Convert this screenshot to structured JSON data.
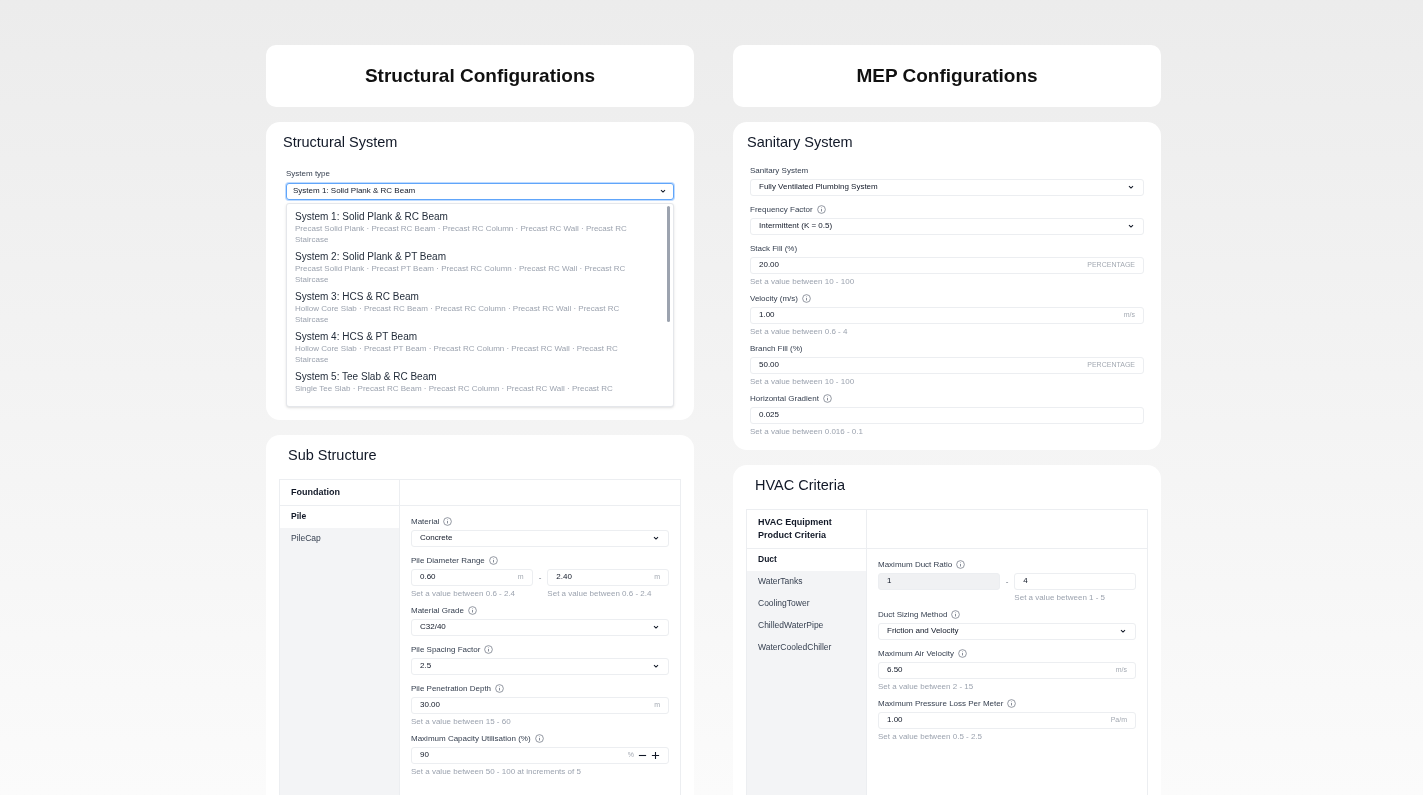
{
  "columns": [
    {
      "heading": "Structural Configurations",
      "sections": [
        {
          "kind": "system",
          "title": "Structural System",
          "field_label": "System type",
          "value": "System 1: Solid Plank & RC Beam",
          "open": true,
          "options": [
            {
              "name": "System 1: Solid Plank & RC Beam",
              "description": "Precast Solid Plank · Precast RC Beam · Precast RC Column · Precast RC Wall · Precast RC Staircase"
            },
            {
              "name": "System 2: Solid Plank & PT Beam",
              "description": "Precast Solid Plank · Precast PT Beam · Precast RC Column · Precast RC Wall · Precast RC Staircase"
            },
            {
              "name": "System 3: HCS & RC Beam",
              "description": "Hollow Core Slab · Precast RC Beam · Precast RC Column · Precast RC Wall · Precast RC Staircase"
            },
            {
              "name": "System 4: HCS & PT Beam",
              "description": "Hollow Core Slab · Precast PT Beam · Precast RC Column · Precast RC Wall · Precast RC Staircase"
            },
            {
              "name": "System 5: Tee Slab & RC Beam",
              "description": "Single Tee Slab · Precast RC Beam · Precast RC Column · Precast RC Wall · Precast RC"
            }
          ]
        },
        {
          "kind": "tabbed",
          "title": "Sub Structure",
          "group": "Foundation",
          "tabs": [
            {
              "label": "Pile",
              "selected": true
            },
            {
              "label": "PileCap",
              "selected": false
            }
          ],
          "fields": [
            {
              "kind": "select",
              "label": "Material",
              "info": true,
              "value": "Concrete"
            },
            {
              "kind": "range",
              "label": "Pile Diameter Range",
              "info": true,
              "separator": "-",
              "min": {
                "value": "0.60",
                "unit": "m",
                "hint": "Set a value between 0.6 - 2.4",
                "disabled": false
              },
              "max": {
                "value": "2.40",
                "unit": "m",
                "hint": "Set a value between 0.6 - 2.4",
                "disabled": false
              }
            },
            {
              "kind": "select",
              "label": "Material Grade",
              "info": true,
              "value": "C32/40"
            },
            {
              "kind": "select",
              "label": "Pile Spacing Factor",
              "info": true,
              "value": "2.5"
            },
            {
              "kind": "number",
              "label": "Pile Penetration Depth",
              "info": true,
              "value": "30.00",
              "unit": "m",
              "hint": "Set a value between 15 - 60"
            },
            {
              "kind": "stepper",
              "label": "Maximum Capacity Utilisation (%)",
              "info": true,
              "value": "90",
              "unit": "%",
              "hint": "Set a value between 50 - 100 at increments of 5"
            }
          ]
        }
      ]
    },
    {
      "heading": "MEP Configurations",
      "sections": [
        {
          "kind": "form",
          "title": "Sanitary System",
          "fields": [
            {
              "kind": "select",
              "label": "Sanitary System",
              "info": false,
              "value": "Fully Ventilated Plumbing System"
            },
            {
              "kind": "select",
              "label": "Frequency Factor",
              "info": true,
              "value": "Intermittent (K = 0.5)"
            },
            {
              "kind": "number",
              "label": "Stack Fill (%)",
              "info": false,
              "value": "20.00",
              "unit": "PERCENTAGE",
              "hint": "Set a value between 10 - 100"
            },
            {
              "kind": "number",
              "label": "Velocity (m/s)",
              "info": true,
              "value": "1.00",
              "unit": "m/s",
              "hint": "Set a value between 0.6 - 4"
            },
            {
              "kind": "number",
              "label": "Branch Fill (%)",
              "info": false,
              "value": "50.00",
              "unit": "PERCENTAGE",
              "hint": "Set a value between 10 - 100"
            },
            {
              "kind": "number",
              "label": "Horizontal Gradient",
              "info": true,
              "value": "0.025",
              "hint": "Set a value between 0.016 - 0.1"
            }
          ]
        },
        {
          "kind": "tabbed",
          "title": "HVAC Criteria",
          "group": "HVAC Equipment Product Criteria",
          "tabs": [
            {
              "label": "Duct",
              "selected": true
            },
            {
              "label": "WaterTanks",
              "selected": false
            },
            {
              "label": "CoolingTower",
              "selected": false
            },
            {
              "label": "ChilledWaterPipe",
              "selected": false
            },
            {
              "label": "WaterCooledChiller",
              "selected": false
            }
          ],
          "fields": [
            {
              "kind": "range",
              "label": "Maximum Duct Ratio",
              "info": true,
              "separator": "-",
              "min": {
                "value": "1",
                "disabled": true
              },
              "max": {
                "value": "4",
                "hint": "Set a value between 1 - 5",
                "disabled": false
              }
            },
            {
              "kind": "select",
              "label": "Duct Sizing Method",
              "info": true,
              "value": "Friction and Velocity"
            },
            {
              "kind": "number",
              "label": "Maximum Air Velocity",
              "info": true,
              "value": "6.50",
              "unit": "m/s",
              "hint": "Set a value between 2 - 15"
            },
            {
              "kind": "number",
              "label": "Maximum Pressure Loss Per Meter",
              "info": true,
              "value": "1.00",
              "unit": "Pa/m",
              "hint": "Set a value between 0.5 - 2.5"
            }
          ]
        }
      ]
    }
  ]
}
